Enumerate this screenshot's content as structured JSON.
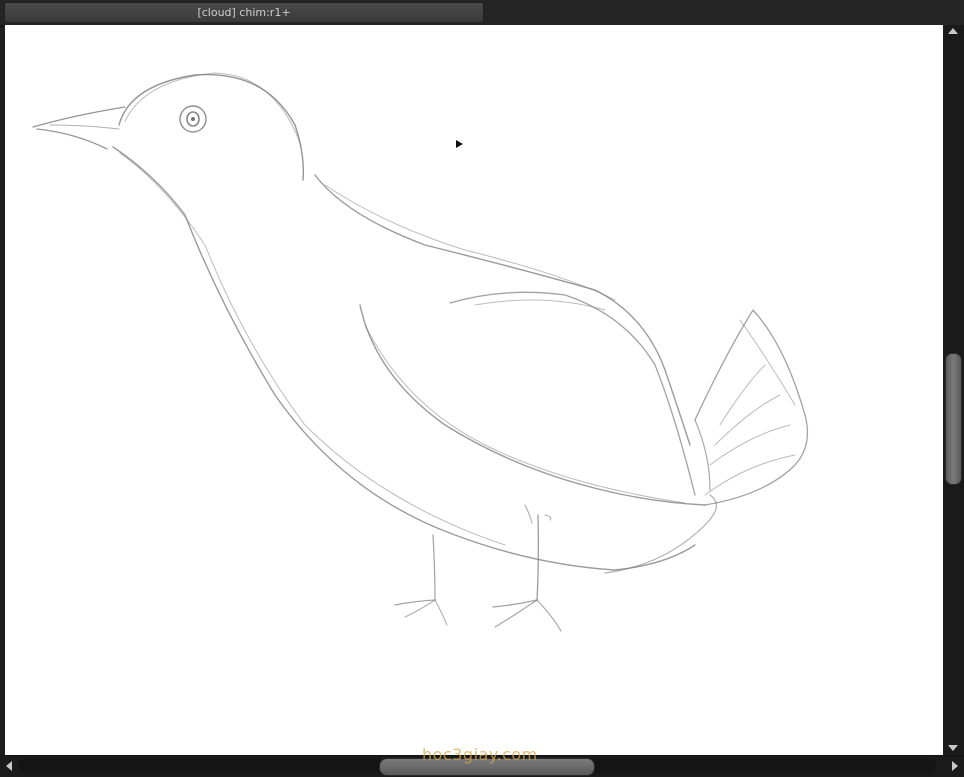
{
  "document": {
    "tab_title": "[cloud] chim:r1+"
  },
  "canvas": {
    "background": "#ffffff",
    "sketch_stroke": "#7a7a7a",
    "content": "pencil-sketch-bird"
  },
  "watermark": {
    "text": "hoc3giay.com",
    "color": "#d8a94a"
  },
  "icons": {
    "scroll_up": "arrow-up-icon",
    "scroll_down": "arrow-down-icon",
    "scroll_left": "arrow-left-icon",
    "scroll_right": "arrow-right-icon",
    "cursor": "pointer-cursor-icon"
  }
}
